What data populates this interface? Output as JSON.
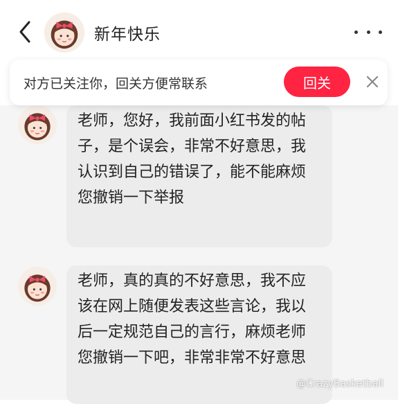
{
  "header": {
    "back_icon": "chevron-left-icon",
    "contact_name": "新年快乐",
    "more_icon": "more-horizontal-icon"
  },
  "banner": {
    "text": "对方已关注你，回关方便常联系",
    "follow_back_label": "回关",
    "close_icon": "close-icon"
  },
  "messages": [
    {
      "text": "老师，您好，我前面小红书发的帖子，是个误会，非常不好意思，我认识到自己的错误了，能不能麻烦您撤销一下举报"
    },
    {
      "text": "老师，真的真的不好意思，我不应该在网上随便发表这些言论，我以后一定规范自己的言行，麻烦老师您撤销一下吧，非常非常不好意思"
    }
  ],
  "watermark": "@CrazyBasketball",
  "colors": {
    "accent": "#ff2442",
    "bubble": "#ececec",
    "chat_background": "#f5f5f5"
  }
}
